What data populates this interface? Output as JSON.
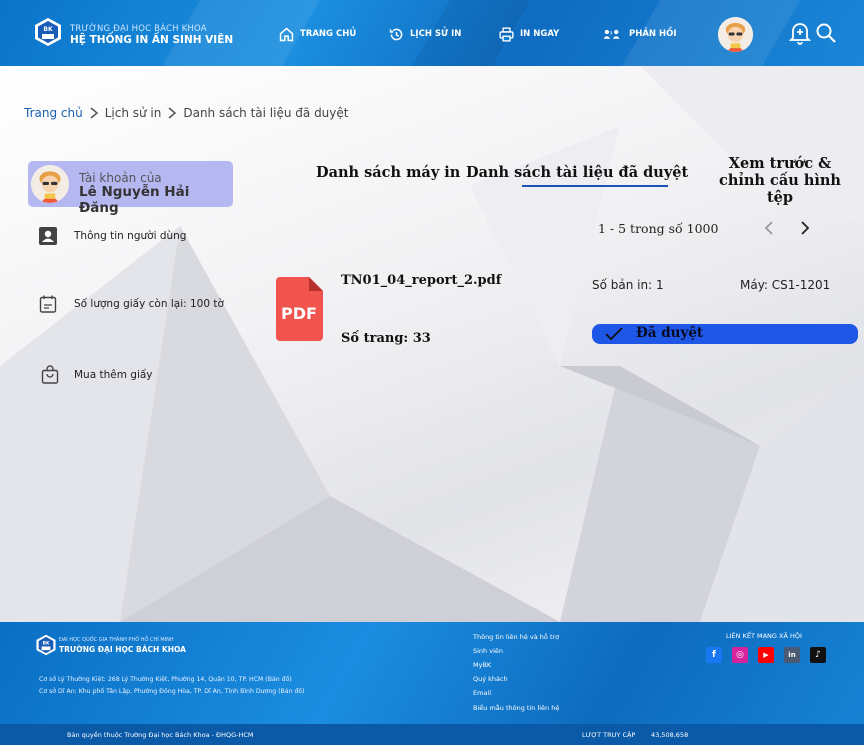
{
  "header": {
    "logo_title": "TRƯỜNG ĐẠI HỌC BÁCH KHOA",
    "logo_subtitle": "HỆ THỐNG IN ẤN SINH VIÊN",
    "nav": {
      "home": "TRANG CHỦ",
      "history": "LỊCH SỬ IN",
      "print_now": "IN NGAY",
      "feedback": "PHẢN HỒI"
    }
  },
  "breadcrumb": [
    "Trang chủ",
    "Lịch sử in",
    "Danh sách tài liệu đã duyệt"
  ],
  "sidebar": {
    "account_label": "Tài khoản của",
    "account_name": "Lê Nguyễn Hải Đăng",
    "items": [
      {
        "label": "Thông tin người dùng",
        "icon": "user-card-icon"
      },
      {
        "label": "Số lượng giấy còn lại: 100 tờ",
        "icon": "calendar-icon"
      },
      {
        "label": "Mua thêm giấy",
        "icon": "shopping-bag-icon"
      }
    ]
  },
  "tabs": {
    "printers": "Danh sách máy in",
    "approved": "Danh sách tài liệu đã duyệt",
    "preview_line1": "Xem trước &",
    "preview_line2": "chỉnh cấu hình tệp"
  },
  "pagination": "1 - 5 trong số 1000",
  "document": {
    "icon_label": "PDF",
    "filename": "TN01_04_report_2.pdf",
    "pages": "Số trang: 33",
    "copies": "Số bản in: 1",
    "printer": "Máy: CS1-1201",
    "status": "Đã duyệt"
  },
  "footer": {
    "small_title": "ĐẠI HỌC QUỐC GIA THÀNH PHỐ HỒ CHÍ MINH",
    "brand": "TRƯỜNG ĐẠI HỌC BÁCH KHOA",
    "address1": "Cơ sở Lý Thường Kiệt: 268 Lý Thường Kiệt, Phường 14, Quận 10, TP. HCM (Bản đồ)",
    "address2": "Cơ sở Dĩ An: Khu phố Tân Lập, Phường Đông Hòa, TP. Dĩ An, Tỉnh Bình Dương (Bản đồ)",
    "links": [
      "Thông tin liên hệ và hỗ trợ",
      "Sinh viên",
      "MyBK",
      "Quý khách",
      "Email",
      "Biểu mẫu thông tin liên hệ"
    ],
    "social_title": "LIÊN KẾT MẠNG XÃ HỘI",
    "social": [
      {
        "name": "facebook-icon",
        "glyph": "f",
        "color": "#1877f2"
      },
      {
        "name": "instagram-icon",
        "glyph": "◎",
        "color": "#d6249f"
      },
      {
        "name": "youtube-icon",
        "glyph": "▶",
        "color": "#ff0000"
      },
      {
        "name": "linkedin-icon",
        "glyph": "in",
        "color": "#4a5a73"
      },
      {
        "name": "tiktok-icon",
        "glyph": "♪",
        "color": "#111111"
      }
    ],
    "copyright": "Bản quyền thuộc Trường Đại học Bách Khoa - ĐHQG-HCM",
    "visits_label": "LƯỢT TRUY CẬP",
    "visits_count": "43,508,658"
  },
  "colors": {
    "header_blue": "#0a74c9",
    "account_bg": "#b5b7f1",
    "status_blue": "#1e56e6",
    "active_underline": "#1a52b8",
    "pdf_red": "#f0544d"
  }
}
